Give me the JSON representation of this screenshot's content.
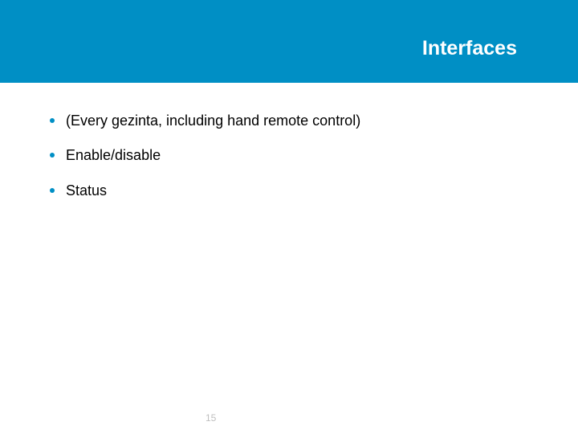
{
  "title": "Interfaces",
  "bullets": [
    "(Every gezinta, including hand remote control)",
    "Enable/disable",
    "Status"
  ],
  "page_number": "15"
}
